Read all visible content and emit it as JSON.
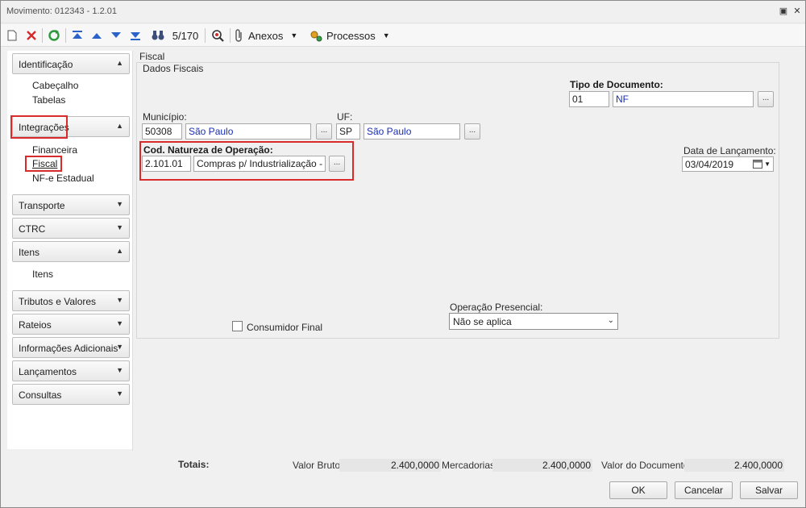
{
  "window": {
    "title": "Movimento: 012343 - 1.2.01"
  },
  "toolbar": {
    "record_counter": "5/170",
    "anexos_label": "Anexos",
    "processos_label": "Processos"
  },
  "sidebar": {
    "groups": [
      {
        "label": "Identificação",
        "expanded": true,
        "items": [
          "Cabeçalho",
          "Tabelas"
        ]
      },
      {
        "label": "Integrações",
        "expanded": true,
        "items": [
          "Financeira",
          "Fiscal",
          "NF-e Estadual"
        ]
      },
      {
        "label": "Transporte",
        "expanded": false
      },
      {
        "label": "CTRC",
        "expanded": false
      },
      {
        "label": "Itens",
        "expanded": true,
        "items": [
          "Itens"
        ]
      },
      {
        "label": "Tributos e Valores",
        "expanded": false
      },
      {
        "label": "Rateios",
        "expanded": false
      },
      {
        "label": "Informações Adicionais",
        "expanded": false
      },
      {
        "label": "Lançamentos",
        "expanded": false
      },
      {
        "label": "Consultas",
        "expanded": false
      }
    ],
    "selected_item": "Fiscal"
  },
  "main": {
    "section_title": "Fiscal",
    "fieldset_legend": "Dados Fiscais",
    "tipo_documento": {
      "label": "Tipo de Documento:",
      "code": "01",
      "name": "NF"
    },
    "municipio": {
      "label": "Município:",
      "code": "50308",
      "name": "São Paulo"
    },
    "uf": {
      "label": "UF:",
      "code": "SP",
      "name": "São Paulo"
    },
    "natureza": {
      "label": "Cod. Natureza de Operação:",
      "code": "2.101.01",
      "description": "Compras p/ Industrialização - Alíc"
    },
    "data_lancamento": {
      "label": "Data de Lançamento:",
      "value": "03/04/2019"
    },
    "consumidor_final": {
      "label": "Consumidor Final",
      "checked": false
    },
    "operacao_presencial": {
      "label": "Operação Presencial:",
      "selected": "Não se aplica"
    },
    "lookup_button": "..."
  },
  "footer": {
    "totais_label": "Totais:",
    "valor_bruto_label": "Valor Bruto:",
    "valor_bruto": "2.400,0000",
    "mercadorias_label": "Mercadorias:",
    "mercadorias": "2.400,0000",
    "valor_documento_label": "Valor do Documento:",
    "valor_documento": "2.400,0000"
  },
  "buttons": {
    "ok": "OK",
    "cancel": "Cancelar",
    "save": "Salvar"
  },
  "colors": {
    "highlight_red": "#d92b2b",
    "link_blue": "#1a2fb0"
  }
}
